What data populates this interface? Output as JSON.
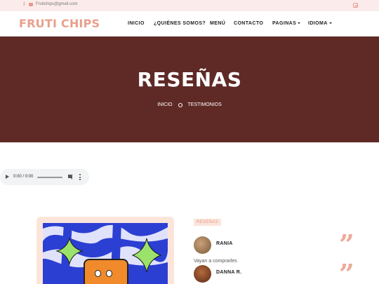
{
  "topbar": {
    "email": "Fruitchips@gmail.com",
    "icons": [
      "phone-icon",
      "mail-icon",
      "instagram-icon"
    ]
  },
  "brand": {
    "name": "FRUTI CHIPS",
    "accent": "#e8a08c",
    "hero_bg": "#5f2a26"
  },
  "nav": {
    "items": [
      {
        "label": "INICIO"
      },
      {
        "label": "¿QUIÉNES SOMOS?"
      },
      {
        "label": "MENÚ"
      },
      {
        "label": "CONTACTO"
      },
      {
        "label": "PAGINAS",
        "dropdown": true
      },
      {
        "label": "IDIOMA",
        "dropdown": true
      }
    ]
  },
  "hero": {
    "title": "RESEÑAS",
    "breadcrumb": [
      "INICIO",
      "TESTIMONIOS"
    ]
  },
  "audio": {
    "time": "0:00 / 0:00",
    "progress": 0
  },
  "testimonials": {
    "tag": "RESEÑAS",
    "items": [
      {
        "name": "RANIA",
        "text": ""
      },
      {
        "name": "DANNA R.",
        "text": "Vayan a comprarles"
      }
    ],
    "quote_glyph": "”"
  }
}
